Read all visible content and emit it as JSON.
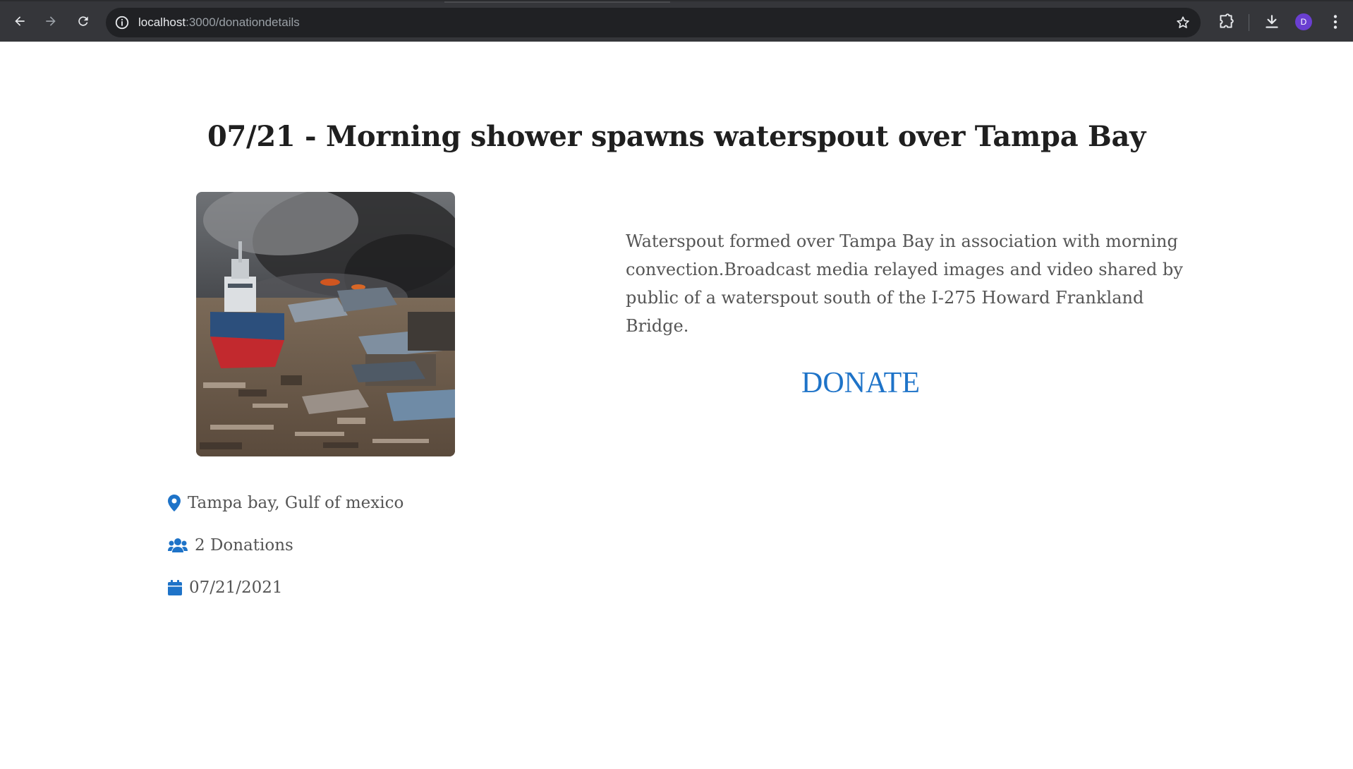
{
  "browser": {
    "url_host": "localhost",
    "url_path": ":3000/donationdetails",
    "profile_initial": "D"
  },
  "page": {
    "title": "07/21 - Morning shower spawns waterspout over Tampa Bay",
    "description": "Waterspout formed over Tampa Bay in association with morning convection.Broadcast media relayed images and video shared by public of a waterspout south of the I-275 Howard Frankland Bridge.",
    "donate_label": "DONATE",
    "location": "Tampa bay, Gulf of mexico",
    "donations": "2 Donations",
    "date": "07/21/2021"
  },
  "colors": {
    "accent": "#1e73c8",
    "chrome_bg": "#35363a",
    "omnibox_bg": "#202124",
    "text_muted": "#555555"
  },
  "icons": {
    "location": "map-marker-icon",
    "donations": "users-icon",
    "date": "calendar-icon"
  }
}
